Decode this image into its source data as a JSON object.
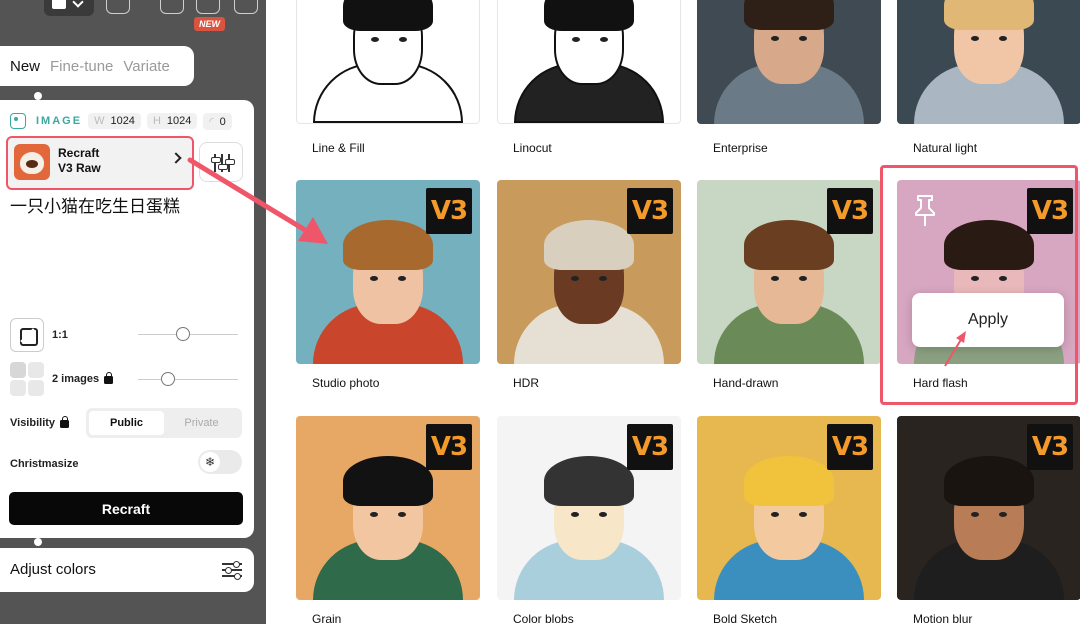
{
  "badges": {
    "new": "NEW"
  },
  "tabs": [
    {
      "label": "New",
      "active": true
    },
    {
      "label": "Fine-tune",
      "active": false
    },
    {
      "label": "Variate",
      "active": false
    }
  ],
  "settings": {
    "image_label": "IMAGE",
    "width_label": "W",
    "width": "1024",
    "height_label": "H",
    "height": "1024",
    "seed": "0",
    "model": {
      "line1": "Recraft",
      "line2": "V3 Raw"
    },
    "prompt": "一只小猫在吃生日蛋糕",
    "aspect_ratio": "1:1",
    "aspect_slider_level": 0.45,
    "image_count": "2 images",
    "count_slider_level": 0.3,
    "visibility_label": "Visibility",
    "visibility_options": [
      "Public",
      "Private"
    ],
    "visibility_selected": "Public",
    "christmasize_label": "Christmasize",
    "christmasize_on": false,
    "generate_button": "Recraft"
  },
  "adjust_colors": {
    "label": "Adjust colors"
  },
  "styles": [
    {
      "label": "Line & Fill",
      "v3": false
    },
    {
      "label": "Linocut",
      "v3": false
    },
    {
      "label": "Enterprise",
      "v3": false
    },
    {
      "label": "Natural light",
      "v3": false
    },
    {
      "label": "Studio photo",
      "v3": true
    },
    {
      "label": "HDR",
      "v3": true
    },
    {
      "label": "Hand-drawn",
      "v3": true
    },
    {
      "label": "Hard flash",
      "v3": true,
      "highlighted": true
    },
    {
      "label": "Grain",
      "v3": true
    },
    {
      "label": "Color blobs",
      "v3": true
    },
    {
      "label": "Bold Sketch",
      "v3": true
    },
    {
      "label": "Motion blur",
      "v3": true
    }
  ],
  "v3_badge": "V3",
  "apply_button": "Apply",
  "colors": {
    "accent_highlight": "#f0566a",
    "brand_teal": "#3aa99f",
    "v3_orange": "#f39a2a"
  }
}
